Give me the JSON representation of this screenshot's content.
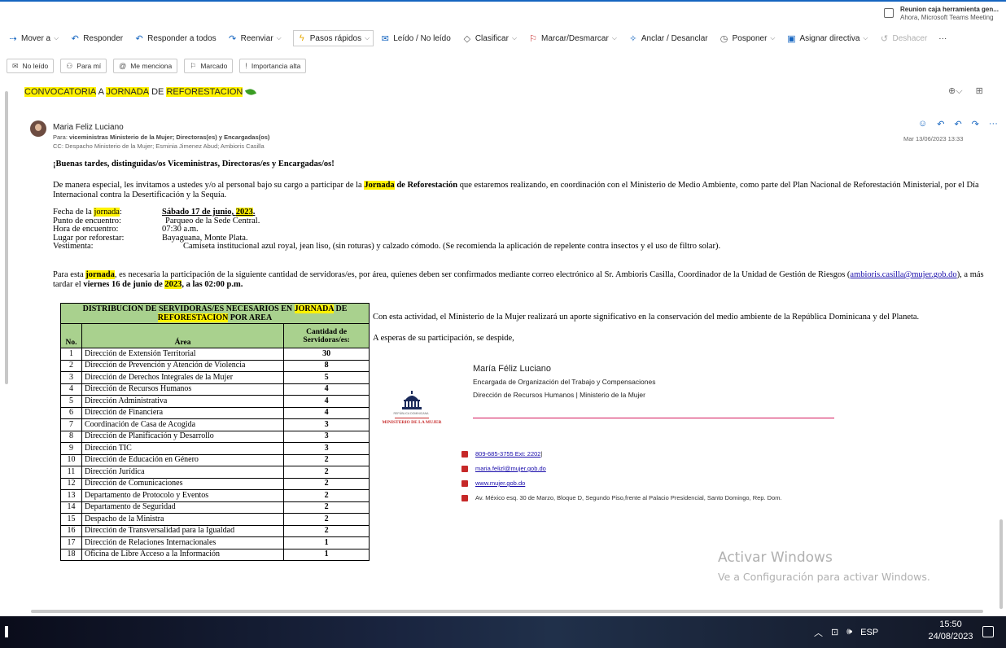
{
  "notification": {
    "title": "Reunion caja herramienta gen...",
    "subtitle": "Ahora, Microsoft Teams Meeting"
  },
  "ribbon": {
    "items": [
      {
        "label": "Mover a",
        "icon": "move-icon",
        "dropdown": true
      },
      {
        "label": "Responder",
        "icon": "reply-icon",
        "dropdown": false
      },
      {
        "label": "Responder a todos",
        "icon": "reply-all-icon",
        "dropdown": false
      },
      {
        "label": "Reenviar",
        "icon": "forward-icon",
        "dropdown": true
      },
      {
        "label": "Pasos rápidos",
        "icon": "lightning-icon",
        "dropdown": true
      },
      {
        "label": "Leído / No leído",
        "icon": "envelope-open-icon",
        "dropdown": false
      },
      {
        "label": "Clasificar",
        "icon": "tag-icon",
        "dropdown": true
      },
      {
        "label": "Marcar/Desmarcar",
        "icon": "flag-icon",
        "dropdown": true
      },
      {
        "label": "Anclar / Desanclar",
        "icon": "pin-icon",
        "dropdown": false
      },
      {
        "label": "Posponer",
        "icon": "clock-icon",
        "dropdown": true
      },
      {
        "label": "Asignar directiva",
        "icon": "policy-icon",
        "dropdown": true
      },
      {
        "label": "Deshacer",
        "icon": "undo-icon",
        "dropdown": false
      },
      {
        "label": "···",
        "icon": "more-icon",
        "dropdown": false
      }
    ]
  },
  "filters": [
    {
      "label": "No leído",
      "icon": "envelope-icon"
    },
    {
      "label": "Para mí",
      "icon": "person-icon"
    },
    {
      "label": "Me menciona",
      "icon": "at-icon"
    },
    {
      "label": "Marcado",
      "icon": "flag-icon"
    },
    {
      "label": "Importancia alta",
      "icon": "exclamation-icon"
    }
  ],
  "subject": {
    "w1": "CONVOCATORIA",
    "w2": " A ",
    "w3": "JORNADA",
    "w4": " DE ",
    "w5": "REFORESTACION"
  },
  "message": {
    "sender": "Maria Feliz Luciano",
    "to_label": "Para:",
    "to": "viceministras Ministerio de la Mujer;  Directoras(es) y Encargadas(os)",
    "cc": "CC:  Despacho Ministerio de la Mujer;  Esminia Jimenez Abud;  Ambioris Casilla",
    "date": "Mar 13/06/2023 13:33"
  },
  "body": {
    "greeting": "¡Buenas tardes, distinguidas/os Viceministras, Directoras/es y Encargadas/os!",
    "p1_a": "De manera especial, les invitamos a ustedes y/o al personal bajo su cargo a participar de la ",
    "p1_jornada": "Jornada",
    "p1_b": " de Reforestación",
    "p1_c": " que estaremos realizando, en coordinación con el Ministerio de Medio Ambiente, como parte del Plan Nacional de Reforestación Ministerial, por el Día Internacional contra la Desertificación y la Sequía.",
    "details": {
      "fecha_k1": "Fecha de la ",
      "fecha_k2": "jornada",
      "fecha_k3": ":",
      "fecha_v1": "Sábado 17 de junio, ",
      "fecha_v2": "2023",
      "fecha_v3": ".",
      "punto_k": "Punto de encuentro:",
      "punto_v": "Parqueo de la Sede Central.",
      "hora_k": "Hora de encuentro:",
      "hora_v": "07:30 a.m.",
      "lugar_k": "Lugar por reforestar:",
      "lugar_v": "Bayaguana, Monte Plata.",
      "vest_k": "Vestimenta:",
      "vest_v": "Camiseta institucional azul royal, jean liso, (sin roturas) y calzado cómodo. (Se recomienda la aplicación de repelente contra insectos y el uso de filtro solar)."
    },
    "p2_a": "Para esta ",
    "p2_jornada": "jornada",
    "p2_b": ", es necesaria la participación de la siguiente cantidad de servidoras/es, por área, quienes deben ser confirmados mediante correo electrónico al Sr. Ambioris Casilla, Coordinador de la Unidad de Gestión de Riesgos (",
    "p2_email": "ambioris.casilla@mujer.gob.do",
    "p2_c": "), a más tardar el ",
    "p2_d": "viernes 16 de junio de ",
    "p2_year": "2023",
    "p2_e": ", a las 02:00 p.m."
  },
  "table": {
    "title_a": "DISTRIBUCION DE SERVIDORAS/ES NECESARIOS EN ",
    "title_jornada": "JORNADA",
    "title_b": " DE ",
    "title_refo": "REFORESTACION",
    "title_c": " POR AREA",
    "col_no": "No.",
    "col_area": "Área",
    "col_count": "Cantidad de Servidoras/es:",
    "rows": [
      {
        "no": "1",
        "area": "Dirección de Extensión Territorial",
        "count": "30"
      },
      {
        "no": "2",
        "area": "Dirección de Prevención y Atención de Violencia",
        "count": "8"
      },
      {
        "no": "3",
        "area": "Dirección de Derechos Integrales de la Mujer",
        "count": "5"
      },
      {
        "no": "4",
        "area": "Dirección de Recursos Humanos",
        "count": "4"
      },
      {
        "no": "5",
        "area": "Dirección Administrativa",
        "count": "4"
      },
      {
        "no": "6",
        "area": "Dirección de Financiera",
        "count": "4"
      },
      {
        "no": "7",
        "area": "Coordinación de Casa de Acogida",
        "count": "3"
      },
      {
        "no": "8",
        "area": "Dirección de Planificación y Desarrollo",
        "count": "3"
      },
      {
        "no": "9",
        "area": "Dirección TIC",
        "count": "3"
      },
      {
        "no": "10",
        "area": "Dirección de Educación en Género",
        "count": "2"
      },
      {
        "no": "11",
        "area": "Dirección Jurídica",
        "count": "2"
      },
      {
        "no": "12",
        "area": "Dirección de Comunicaciones",
        "count": "2"
      },
      {
        "no": "13",
        "area": "Departamento de Protocolo y Eventos",
        "count": "2"
      },
      {
        "no": "14",
        "area": "Departamento de Seguridad",
        "count": "2"
      },
      {
        "no": "15",
        "area": "Despacho de la Ministra",
        "count": "2"
      },
      {
        "no": "16",
        "area": "Dirección de Transversalidad para la Igualdad",
        "count": "2"
      },
      {
        "no": "17",
        "area": "Dirección de Relaciones Internacionales",
        "count": "1"
      },
      {
        "no": "18",
        "area": "Oficina de Libre Acceso a la Información",
        "count": "1"
      }
    ]
  },
  "closing": {
    "line1": "Con esta actividad, el Ministerio de la Mujer realizará un aporte significativo en la conservación del medio ambiente de la República Dominicana y del Planeta.",
    "line2": "A esperas de su participación, se despide,"
  },
  "signature": {
    "name": "María Féliz Luciano",
    "role": "Encargada de Organización del Trabajo y Compensaciones",
    "dept": "Dirección de Recursos Humanos | Ministerio de la Mujer",
    "logo_top": "REPÚBLICA DOMINICANA",
    "logo_bottom": "MINISTERIO DE LA MUJER",
    "phone": "809-685-3755 Ext: 2202",
    "phone_sep": " |",
    "email": "maria.felizl@mujer.gob.do",
    "web": "www.mujer.gob.do",
    "address": "Av. México esq. 30 de Marzo, Bloque D, Segundo Piso,frente al Palacio Presidencial, Santo Domingo, Rep. Dom."
  },
  "watermark": {
    "line1": "Activar Windows",
    "line2": "Ve a Configuración para activar Windows."
  },
  "taskbar": {
    "lang": "ESP",
    "time": "15:50",
    "date": "24/08/2023"
  },
  "colors": {
    "accent": "#1565c0",
    "highlight": "#fff200",
    "table_header": "#a9d18e",
    "signature_line": "#d4145a"
  }
}
